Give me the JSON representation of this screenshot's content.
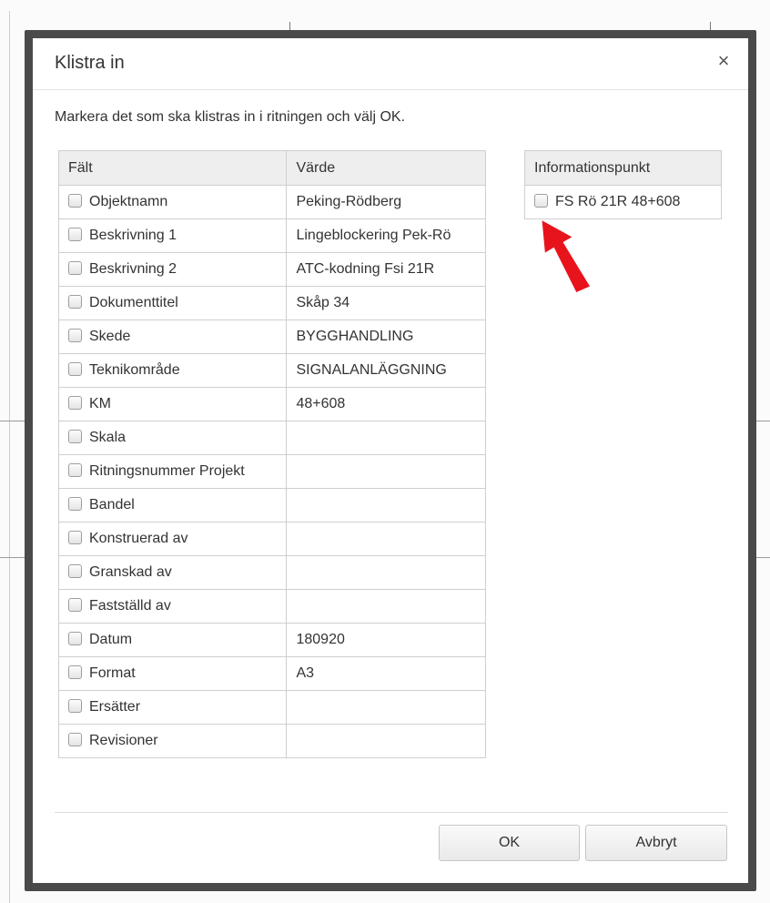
{
  "dialog": {
    "title": "Klistra in",
    "close_glyph": "×",
    "instruction": "Markera det som ska klistras in i ritningen och välj OK."
  },
  "fields_table": {
    "headers": [
      "Fält",
      "Värde"
    ],
    "rows": [
      {
        "field": "Objektnamn",
        "value": "Peking-Rödberg"
      },
      {
        "field": "Beskrivning 1",
        "value": "Lingeblockering Pek-Rö"
      },
      {
        "field": "Beskrivning 2",
        "value": "ATC-kodning Fsi 21R"
      },
      {
        "field": "Dokumenttitel",
        "value": "Skåp 34"
      },
      {
        "field": "Skede",
        "value": "BYGGHANDLING"
      },
      {
        "field": "Teknikområde",
        "value": "SIGNALANLÄGGNING"
      },
      {
        "field": "KM",
        "value": "48+608"
      },
      {
        "field": "Skala",
        "value": ""
      },
      {
        "field": "Ritningsnummer Projekt",
        "value": ""
      },
      {
        "field": "Bandel",
        "value": ""
      },
      {
        "field": "Konstruerad av",
        "value": ""
      },
      {
        "field": "Granskad av",
        "value": ""
      },
      {
        "field": "Fastställd av",
        "value": ""
      },
      {
        "field": "Datum",
        "value": "180920"
      },
      {
        "field": "Format",
        "value": "A3"
      },
      {
        "field": "Ersätter",
        "value": ""
      },
      {
        "field": "Revisioner",
        "value": ""
      }
    ]
  },
  "info_table": {
    "header": "Informationspunkt",
    "rows": [
      {
        "label": "FS Rö 21R 48+608"
      }
    ]
  },
  "buttons": {
    "ok_label": "OK",
    "cancel_label": "Avbryt"
  },
  "colors": {
    "arrow": "#e8141c",
    "header_bg": "#eeeeee",
    "modal_border": "#4a4a4a"
  }
}
